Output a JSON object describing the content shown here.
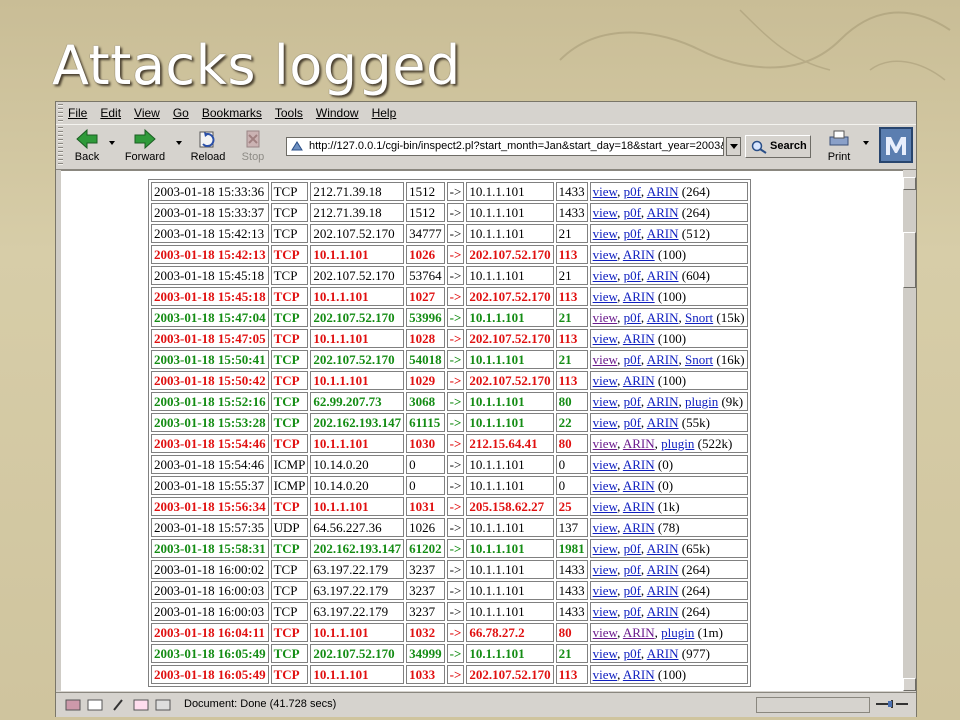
{
  "slide": {
    "title": "Attacks logged"
  },
  "browser": {
    "menu": [
      "File",
      "Edit",
      "View",
      "Go",
      "Bookmarks",
      "Tools",
      "Window",
      "Help"
    ],
    "toolbar": {
      "back": "Back",
      "forward": "Forward",
      "reload": "Reload",
      "stop": "Stop",
      "search": "Search",
      "print": "Print",
      "url": "http://127.0.0.1/cgi-bin/inspect2.pl?start_month=Jan&start_day=18&start_year=2003&"
    },
    "status": "Document: Done (41.728 secs)"
  },
  "colors": {
    "red": "#e01010",
    "green": "#148c14",
    "link": "#1020c0",
    "visited": "#6a1a8c"
  },
  "table": {
    "rows": [
      {
        "style": "plain",
        "time": "2003-01-18 15:33:36",
        "proto": "TCP",
        "src": "212.71.39.18",
        "sport": "1512",
        "dst": "10.1.1.101",
        "dport": "1433",
        "links": [
          "view",
          "p0f",
          "ARIN"
        ],
        "size": "(264)"
      },
      {
        "style": "plain",
        "time": "2003-01-18 15:33:37",
        "proto": "TCP",
        "src": "212.71.39.18",
        "sport": "1512",
        "dst": "10.1.1.101",
        "dport": "1433",
        "links": [
          "view",
          "p0f",
          "ARIN"
        ],
        "size": "(264)"
      },
      {
        "style": "plain",
        "time": "2003-01-18 15:42:13",
        "proto": "TCP",
        "src": "202.107.52.170",
        "sport": "34777",
        "dst": "10.1.1.101",
        "dport": "21",
        "links": [
          "view",
          "p0f",
          "ARIN"
        ],
        "size": "(512)"
      },
      {
        "style": "red",
        "time": "2003-01-18 15:42:13",
        "proto": "TCP",
        "src": "10.1.1.101",
        "sport": "1026",
        "dst": "202.107.52.170",
        "dport": "113",
        "links": [
          "view",
          "ARIN"
        ],
        "size": "(100)"
      },
      {
        "style": "plain",
        "time": "2003-01-18 15:45:18",
        "proto": "TCP",
        "src": "202.107.52.170",
        "sport": "53764",
        "dst": "10.1.1.101",
        "dport": "21",
        "links": [
          "view",
          "p0f",
          "ARIN"
        ],
        "size": "(604)"
      },
      {
        "style": "red",
        "time": "2003-01-18 15:45:18",
        "proto": "TCP",
        "src": "10.1.1.101",
        "sport": "1027",
        "dst": "202.107.52.170",
        "dport": "113",
        "links": [
          "view",
          "ARIN"
        ],
        "size": "(100)"
      },
      {
        "style": "green",
        "time": "2003-01-18 15:47:04",
        "proto": "TCP",
        "src": "202.107.52.170",
        "sport": "53996",
        "dst": "10.1.1.101",
        "dport": "21",
        "links": [
          "view",
          "p0f",
          "ARIN",
          "Snort"
        ],
        "size": "(15k)"
      },
      {
        "style": "red",
        "time": "2003-01-18 15:47:05",
        "proto": "TCP",
        "src": "10.1.1.101",
        "sport": "1028",
        "dst": "202.107.52.170",
        "dport": "113",
        "links": [
          "view",
          "ARIN"
        ],
        "size": "(100)"
      },
      {
        "style": "green",
        "time": "2003-01-18 15:50:41",
        "proto": "TCP",
        "src": "202.107.52.170",
        "sport": "54018",
        "dst": "10.1.1.101",
        "dport": "21",
        "links": [
          "view",
          "p0f",
          "ARIN",
          "Snort"
        ],
        "size": "(16k)"
      },
      {
        "style": "red",
        "time": "2003-01-18 15:50:42",
        "proto": "TCP",
        "src": "10.1.1.101",
        "sport": "1029",
        "dst": "202.107.52.170",
        "dport": "113",
        "links": [
          "view",
          "ARIN"
        ],
        "size": "(100)"
      },
      {
        "style": "green",
        "time": "2003-01-18 15:52:16",
        "proto": "TCP",
        "src": "62.99.207.73",
        "sport": "3068",
        "dst": "10.1.1.101",
        "dport": "80",
        "links": [
          "view",
          "p0f",
          "ARIN",
          "plugin"
        ],
        "size": "(9k)"
      },
      {
        "style": "green",
        "time": "2003-01-18 15:53:28",
        "proto": "TCP",
        "src": "202.162.193.147",
        "sport": "61115",
        "dst": "10.1.1.101",
        "dport": "22",
        "links": [
          "view",
          "p0f",
          "ARIN"
        ],
        "size": "(55k)"
      },
      {
        "style": "red",
        "time": "2003-01-18 15:54:46",
        "proto": "TCP",
        "src": "10.1.1.101",
        "sport": "1030",
        "dst": "212.15.64.41",
        "dport": "80",
        "links": [
          "view",
          "ARIN",
          "plugin"
        ],
        "size": "(522k)"
      },
      {
        "style": "plain",
        "time": "2003-01-18 15:54:46",
        "proto": "ICMP",
        "src": "10.14.0.20",
        "sport": "0",
        "dst": "10.1.1.101",
        "dport": "0",
        "links": [
          "view",
          "ARIN"
        ],
        "size": "(0)"
      },
      {
        "style": "plain",
        "time": "2003-01-18 15:55:37",
        "proto": "ICMP",
        "src": "10.14.0.20",
        "sport": "0",
        "dst": "10.1.1.101",
        "dport": "0",
        "links": [
          "view",
          "ARIN"
        ],
        "size": "(0)"
      },
      {
        "style": "red",
        "time": "2003-01-18 15:56:34",
        "proto": "TCP",
        "src": "10.1.1.101",
        "sport": "1031",
        "dst": "205.158.62.27",
        "dport": "25",
        "links": [
          "view",
          "ARIN"
        ],
        "size": "(1k)"
      },
      {
        "style": "plain",
        "time": "2003-01-18 15:57:35",
        "proto": "UDP",
        "src": "64.56.227.36",
        "sport": "1026",
        "dst": "10.1.1.101",
        "dport": "137",
        "links": [
          "view",
          "ARIN"
        ],
        "size": "(78)"
      },
      {
        "style": "green",
        "time": "2003-01-18 15:58:31",
        "proto": "TCP",
        "src": "202.162.193.147",
        "sport": "61202",
        "dst": "10.1.1.101",
        "dport": "1981",
        "links": [
          "view",
          "p0f",
          "ARIN"
        ],
        "size": "(65k)"
      },
      {
        "style": "plain",
        "time": "2003-01-18 16:00:02",
        "proto": "TCP",
        "src": "63.197.22.179",
        "sport": "3237",
        "dst": "10.1.1.101",
        "dport": "1433",
        "links": [
          "view",
          "p0f",
          "ARIN"
        ],
        "size": "(264)"
      },
      {
        "style": "plain",
        "time": "2003-01-18 16:00:03",
        "proto": "TCP",
        "src": "63.197.22.179",
        "sport": "3237",
        "dst": "10.1.1.101",
        "dport": "1433",
        "links": [
          "view",
          "p0f",
          "ARIN"
        ],
        "size": "(264)"
      },
      {
        "style": "plain",
        "time": "2003-01-18 16:00:03",
        "proto": "TCP",
        "src": "63.197.22.179",
        "sport": "3237",
        "dst": "10.1.1.101",
        "dport": "1433",
        "links": [
          "view",
          "p0f",
          "ARIN"
        ],
        "size": "(264)"
      },
      {
        "style": "red",
        "time": "2003-01-18 16:04:11",
        "proto": "TCP",
        "src": "10.1.1.101",
        "sport": "1032",
        "dst": "66.78.27.2",
        "dport": "80",
        "links": [
          "view",
          "ARIN",
          "plugin"
        ],
        "size": "(1m)"
      },
      {
        "style": "green",
        "time": "2003-01-18 16:05:49",
        "proto": "TCP",
        "src": "202.107.52.170",
        "sport": "34999",
        "dst": "10.1.1.101",
        "dport": "21",
        "links": [
          "view",
          "p0f",
          "ARIN"
        ],
        "size": "(977)"
      },
      {
        "style": "red",
        "time": "2003-01-18 16:05:49",
        "proto": "TCP",
        "src": "10.1.1.101",
        "sport": "1033",
        "dst": "202.107.52.170",
        "dport": "113",
        "links": [
          "view",
          "ARIN"
        ],
        "size": "(100)"
      }
    ]
  }
}
